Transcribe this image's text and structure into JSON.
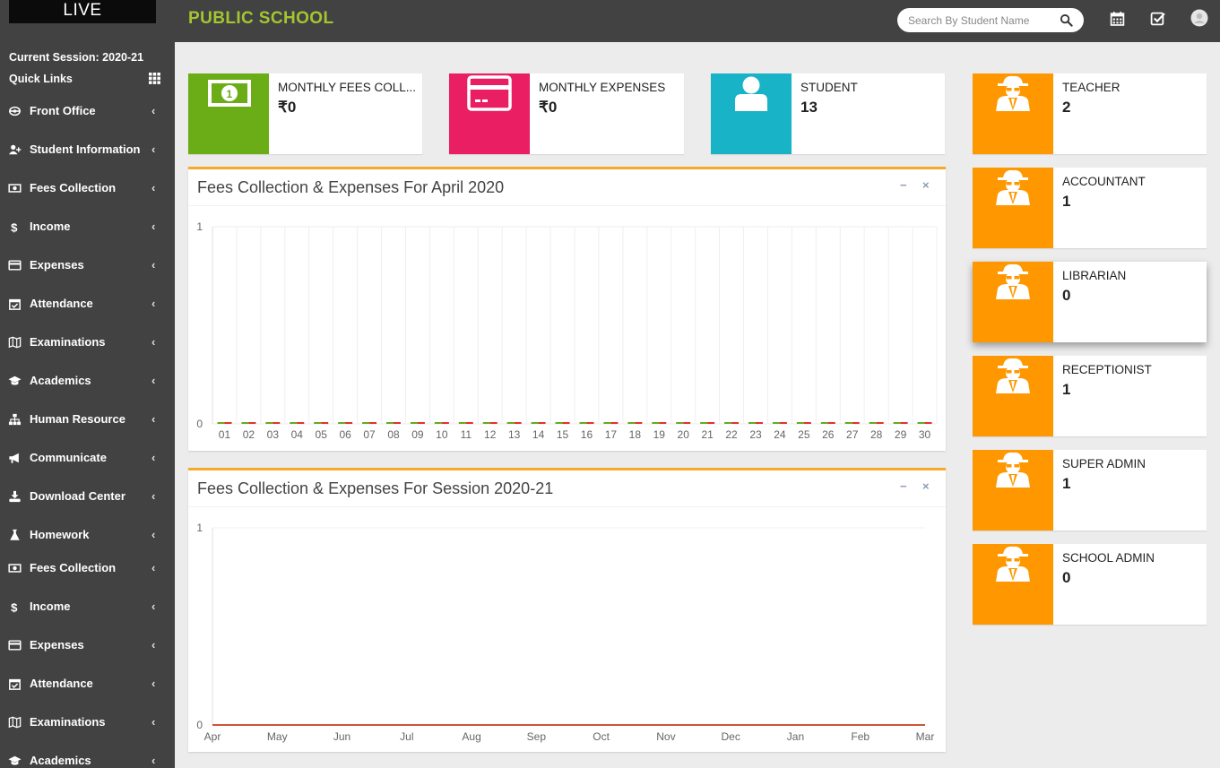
{
  "header": {
    "logo_text": "LIVE",
    "school_name": "PUBLIC SCHOOL",
    "search_placeholder": "Search By Student Name",
    "icons": [
      "search-icon",
      "calendar-icon",
      "task-check-icon",
      "user-avatar-icon"
    ]
  },
  "sidebar": {
    "session": "Current Session: 2020-21",
    "quick_links": "Quick Links",
    "items": [
      {
        "label": "Front Office",
        "icon": "front-office-icon"
      },
      {
        "label": "Student Information",
        "icon": "user-plus-icon"
      },
      {
        "label": "Fees Collection",
        "icon": "money-icon"
      },
      {
        "label": "Income",
        "icon": "dollar-icon"
      },
      {
        "label": "Expenses",
        "icon": "credit-card-icon"
      },
      {
        "label": "Attendance",
        "icon": "calendar-check-icon"
      },
      {
        "label": "Examinations",
        "icon": "map-icon"
      },
      {
        "label": "Academics",
        "icon": "graduation-cap-icon"
      },
      {
        "label": "Human Resource",
        "icon": "sitemap-icon"
      },
      {
        "label": "Communicate",
        "icon": "bullhorn-icon"
      },
      {
        "label": "Download Center",
        "icon": "download-icon"
      },
      {
        "label": "Homework",
        "icon": "flask-icon"
      },
      {
        "label": "Fees Collection",
        "icon": "money-icon"
      },
      {
        "label": "Income",
        "icon": "dollar-icon"
      },
      {
        "label": "Expenses",
        "icon": "credit-card-icon"
      },
      {
        "label": "Attendance",
        "icon": "calendar-check-icon"
      },
      {
        "label": "Examinations",
        "icon": "map-icon"
      },
      {
        "label": "Academics",
        "icon": "graduation-cap-icon"
      }
    ],
    "chevron": "‹"
  },
  "stats": [
    {
      "label": "MONTHLY FEES COLL...",
      "value": "₹0",
      "color": "#6aad16",
      "icon": "money-bill-icon"
    },
    {
      "label": "MONTHLY EXPENSES",
      "value": "₹0",
      "color": "#e91e63",
      "icon": "credit-card-icon"
    },
    {
      "label": "STUDENT",
      "value": "13",
      "color": "#18b3c7",
      "icon": "user-icon"
    }
  ],
  "roles": [
    {
      "label": "TEACHER",
      "value": "2",
      "icon": "user-secret-icon"
    },
    {
      "label": "ACCOUNTANT",
      "value": "1",
      "icon": "user-secret-icon"
    },
    {
      "label": "LIBRARIAN",
      "value": "0",
      "icon": "user-secret-icon"
    },
    {
      "label": "RECEPTIONIST",
      "value": "1",
      "icon": "user-secret-icon"
    },
    {
      "label": "SUPER ADMIN",
      "value": "1",
      "icon": "user-secret-icon"
    },
    {
      "label": "SCHOOL ADMIN",
      "value": "0",
      "icon": "user-secret-icon"
    }
  ],
  "role_color": "#ff9800",
  "panel_buttons": {
    "minimize": "−",
    "close": "×"
  },
  "chart_data": [
    {
      "type": "bar",
      "title": "Fees Collection & Expenses For April 2020",
      "categories": [
        "01",
        "02",
        "03",
        "04",
        "05",
        "06",
        "07",
        "08",
        "09",
        "10",
        "11",
        "12",
        "13",
        "14",
        "15",
        "16",
        "17",
        "18",
        "19",
        "20",
        "21",
        "22",
        "23",
        "24",
        "25",
        "26",
        "27",
        "28",
        "29",
        "30"
      ],
      "series": [
        {
          "color": "#66aa22",
          "values": [
            0,
            0,
            0,
            0,
            0,
            0,
            0,
            0,
            0,
            0,
            0,
            0,
            0,
            0,
            0,
            0,
            0,
            0,
            0,
            0,
            0,
            0,
            0,
            0,
            0,
            0,
            0,
            0,
            0,
            0
          ]
        },
        {
          "color": "#e4322b",
          "values": [
            0,
            0,
            0,
            0,
            0,
            0,
            0,
            0,
            0,
            0,
            0,
            0,
            0,
            0,
            0,
            0,
            0,
            0,
            0,
            0,
            0,
            0,
            0,
            0,
            0,
            0,
            0,
            0,
            0,
            0
          ]
        }
      ],
      "yticks": [
        "0",
        "1"
      ],
      "ylim": [
        0,
        1
      ],
      "grid": true
    },
    {
      "type": "line",
      "title": "Fees Collection & Expenses For Session 2020-21",
      "categories": [
        "Apr",
        "May",
        "Jun",
        "Jul",
        "Aug",
        "Sep",
        "Oct",
        "Nov",
        "Dec",
        "Jan",
        "Feb",
        "Mar"
      ],
      "series": [
        {
          "color": "#66aa22",
          "values": [
            0,
            0,
            0,
            0,
            0,
            0,
            0,
            0,
            0,
            0,
            0,
            0
          ]
        },
        {
          "color": "#e4322b",
          "values": [
            0,
            0,
            0,
            0,
            0,
            0,
            0,
            0,
            0,
            0,
            0,
            0
          ]
        }
      ],
      "yticks": [
        "0",
        "1"
      ],
      "ylim": [
        0,
        1
      ],
      "grid": false
    }
  ]
}
